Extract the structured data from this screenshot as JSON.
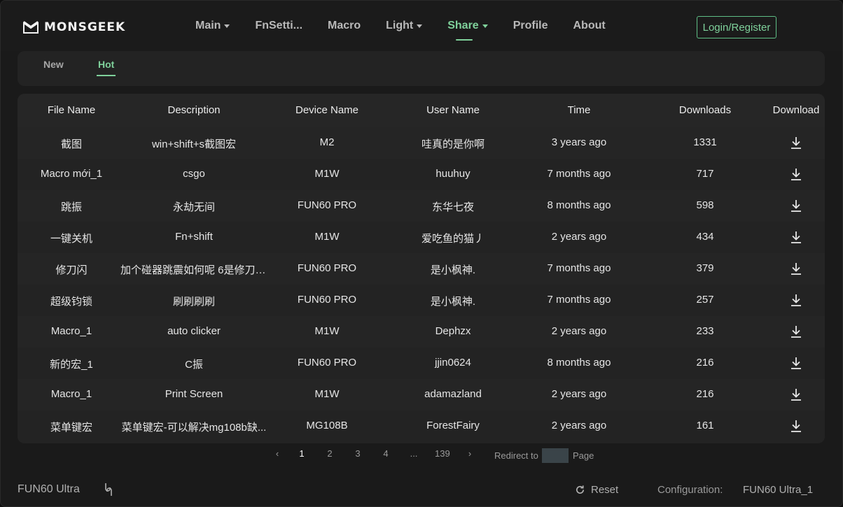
{
  "brand": {
    "name": "MONSGEEK"
  },
  "nav": {
    "items": [
      {
        "label": "Main",
        "dropdown": true,
        "active": false
      },
      {
        "label": "FnSetti...",
        "dropdown": false,
        "active": false
      },
      {
        "label": "Macro",
        "dropdown": false,
        "active": false
      },
      {
        "label": "Light",
        "dropdown": true,
        "active": false
      },
      {
        "label": "Share",
        "dropdown": true,
        "active": true
      },
      {
        "label": "Profile",
        "dropdown": false,
        "active": false
      },
      {
        "label": "About",
        "dropdown": false,
        "active": false
      }
    ],
    "login_label": "Login/Register"
  },
  "tabs": [
    {
      "label": "New",
      "active": false
    },
    {
      "label": "Hot",
      "active": true
    }
  ],
  "table": {
    "columns": [
      "File Name",
      "Description",
      "Device Name",
      "User Name",
      "Time",
      "Downloads",
      "Download"
    ],
    "rows": [
      {
        "file": "截图",
        "desc": "win+shift+s截图宏",
        "device": "M2",
        "user": "哇真的是你啊",
        "time": "3 years ago",
        "downloads": "1331"
      },
      {
        "file": "Macro mới_1",
        "desc": "csgo",
        "device": "M1W",
        "user": "huuhuy",
        "time": "7 months ago",
        "downloads": "717"
      },
      {
        "file": "跳振",
        "desc": "永劫无间",
        "device": "FUN60 PRO",
        "user": "东华七夜",
        "time": "8 months ago",
        "downloads": "598"
      },
      {
        "file": "一键关机",
        "desc": "Fn+shift",
        "device": "M1W",
        "user": "爱吃鱼的猫丿",
        "time": "2 years ago",
        "downloads": "434"
      },
      {
        "file": "修刀闪",
        "desc": "加个碰器跳震如何呢 6是修刀6...",
        "device": "FUN60 PRO",
        "user": "是小枫神.",
        "time": "7 months ago",
        "downloads": "379"
      },
      {
        "file": "超级钧锁",
        "desc": "刷刷刷刷",
        "device": "FUN60 PRO",
        "user": "是小枫神.",
        "time": "7 months ago",
        "downloads": "257"
      },
      {
        "file": "Macro_1",
        "desc": "auto clicker",
        "device": "M1W",
        "user": "Dephzx",
        "time": "2 years ago",
        "downloads": "233"
      },
      {
        "file": "新的宏_1",
        "desc": "C振",
        "device": "FUN60 PRO",
        "user": "jjin0624",
        "time": "8 months ago",
        "downloads": "216"
      },
      {
        "file": "Macro_1",
        "desc": "Print Screen",
        "device": "M1W",
        "user": "adamazland",
        "time": "2 years ago",
        "downloads": "216"
      },
      {
        "file": "菜单键宏",
        "desc": "菜单键宏-可以解决mg108b缺...",
        "device": "MG108B",
        "user": "ForestFairy",
        "time": "2 years ago",
        "downloads": "161"
      }
    ]
  },
  "pagination": {
    "prev": "‹",
    "next": "›",
    "pages": [
      "1",
      "2",
      "3",
      "4",
      "...",
      "139"
    ],
    "current": "1",
    "redirect_label": "Redirect to",
    "redirect_value": "",
    "page_label": "Page"
  },
  "footer": {
    "device": "FUN60 Ultra",
    "reset_label": "Reset",
    "config_label": "Configuration:",
    "config_value": "FUN60 Ultra_1"
  },
  "colors": {
    "accent": "#7fd19b",
    "background": "#1a1a1a",
    "panel": "#232323"
  }
}
